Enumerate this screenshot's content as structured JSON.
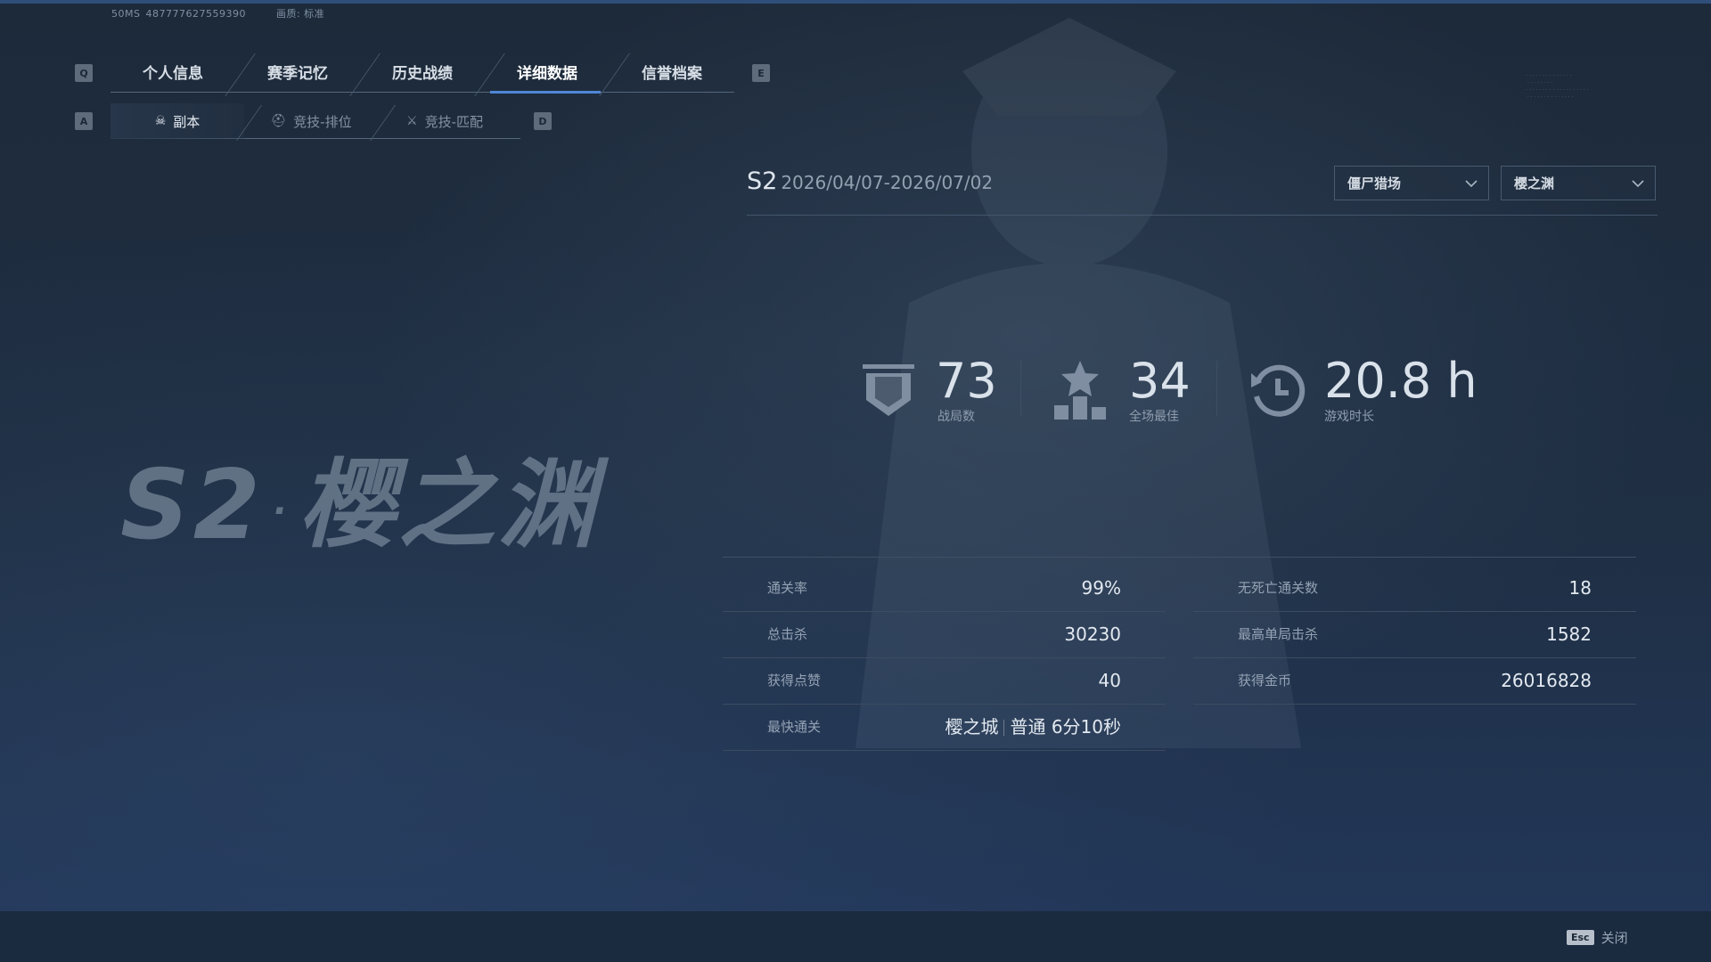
{
  "meta": {
    "ping": "50MS",
    "uid": "487777627559390",
    "quality": "画质: 标准"
  },
  "keys": {
    "prev_tab": "Q",
    "next_tab": "E",
    "prev_sub": "A",
    "next_sub": "D",
    "close": "Esc"
  },
  "main_tabs": [
    {
      "label": "个人信息"
    },
    {
      "label": "赛季记忆"
    },
    {
      "label": "历史战绩"
    },
    {
      "label": "详细数据",
      "active": true
    },
    {
      "label": "信誉档案"
    }
  ],
  "sub_tabs": [
    {
      "label": "副本",
      "icon": "skull-icon",
      "active": true
    },
    {
      "label": "竞技-排位",
      "icon": "helmet-icon"
    },
    {
      "label": "竞技-匹配",
      "icon": "crossed-swords-icon"
    }
  ],
  "hero_title": {
    "season": "S2",
    "name": "樱之渊"
  },
  "season": {
    "name": "S2",
    "dates": "2026/04/07-2026/07/02"
  },
  "filters": {
    "mode": "僵尸猎场",
    "map": "樱之渊"
  },
  "summary": [
    {
      "icon": "shield-icon",
      "value": "73",
      "label": "战局数"
    },
    {
      "icon": "star-podium-icon",
      "value": "34",
      "label": "全场最佳"
    },
    {
      "icon": "clock-history-icon",
      "value": "20.8 h",
      "label": "游戏时长"
    }
  ],
  "stats_left": [
    {
      "label": "通关率",
      "value": "99%"
    },
    {
      "label": "总击杀",
      "value": "30230"
    },
    {
      "label": "获得点赞",
      "value": "40"
    }
  ],
  "fastest": {
    "label": "最快通关",
    "map": "樱之城",
    "difficulty": "普通",
    "time": "6分10秒"
  },
  "stats_right": [
    {
      "label": "无死亡通关数",
      "value": "18"
    },
    {
      "label": "最高单局击杀",
      "value": "1582"
    },
    {
      "label": "获得金币",
      "value": "26016828"
    }
  ],
  "close_label": "关闭",
  "colors": {
    "accent": "#4f86d6",
    "background": "#1b2a3d"
  }
}
